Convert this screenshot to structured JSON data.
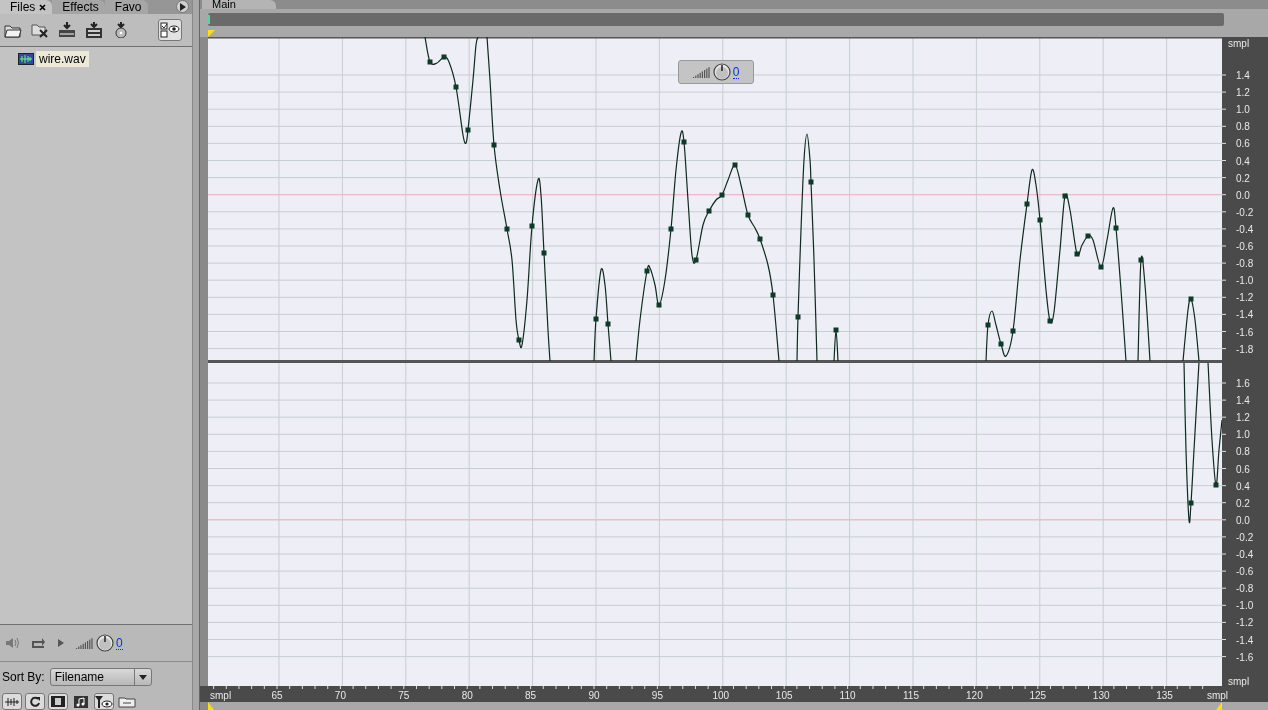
{
  "left_panel": {
    "tabs": [
      {
        "label": "Files",
        "selected": true,
        "closable": true
      },
      {
        "label": "Effects",
        "selected": false,
        "closable": false
      },
      {
        "label": "Favo",
        "selected": false,
        "closable": false
      }
    ],
    "files": [
      {
        "name": "wire.wav",
        "selected": true
      }
    ],
    "transport": {
      "volume": "0"
    },
    "sort": {
      "label": "Sort By:",
      "value": "Filename"
    }
  },
  "main": {
    "tab": "Main",
    "volume": "0",
    "channels": [
      {
        "unit": "smpl",
        "ticks": [
          "1.4",
          "1.2",
          "1.0",
          "0.8",
          "0.6",
          "0.4",
          "0.2",
          "0.0",
          "-0.2",
          "-0.4",
          "-0.6",
          "-0.8",
          "-1.0",
          "-1.2",
          "-1.4",
          "-1.6",
          "-1.8"
        ]
      },
      {
        "unit": "smpl",
        "ticks": [
          "1.6",
          "1.4",
          "1.2",
          "1.0",
          "0.8",
          "0.6",
          "0.4",
          "0.2",
          "0.0",
          "-0.2",
          "-0.4",
          "-0.6",
          "-0.8",
          "-1.0",
          "-1.2",
          "-1.4",
          "-1.6"
        ]
      }
    ],
    "time_ruler": {
      "start_label": "smpl",
      "ticks": [
        "65",
        "70",
        "75",
        "80",
        "85",
        "90",
        "95",
        "100",
        "105",
        "110",
        "115",
        "120",
        "125",
        "130",
        "135"
      ],
      "end_label": "smpl"
    }
  }
}
